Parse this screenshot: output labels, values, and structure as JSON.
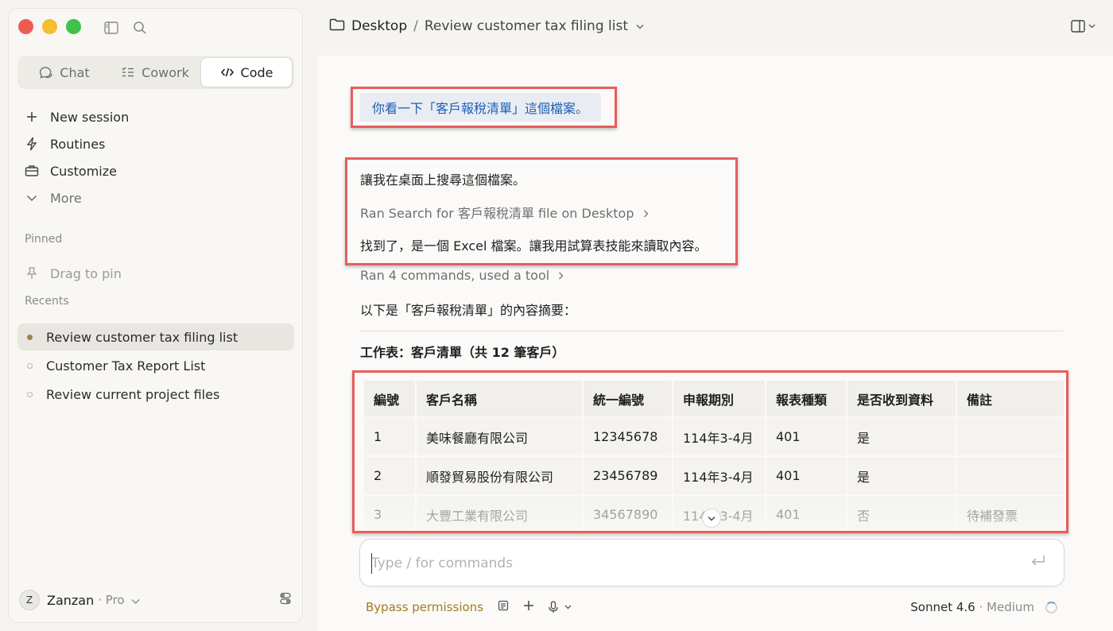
{
  "window": {
    "breadcrumb_root": "Desktop",
    "breadcrumb_separator": "/",
    "breadcrumb_page": "Review customer tax filing list"
  },
  "sidebar": {
    "modes": [
      {
        "label": "Chat",
        "icon": "chat-bubble-icon"
      },
      {
        "label": "Cowork",
        "icon": "checklist-icon"
      },
      {
        "label": "Code",
        "icon": "code-brackets-icon"
      }
    ],
    "active_mode": "Code",
    "nav": [
      {
        "label": "New session",
        "icon": "plus-icon"
      },
      {
        "label": "Routines",
        "icon": "bolt-icon"
      },
      {
        "label": "Customize",
        "icon": "briefcase-icon"
      },
      {
        "label": "More",
        "icon": "chevron-down-icon"
      }
    ],
    "pinned_label": "Pinned",
    "pinned_placeholder": "Drag to pin",
    "recents_label": "Recents",
    "recents": [
      {
        "label": "Review customer tax filing list",
        "active": true
      },
      {
        "label": "Customer Tax Report List",
        "active": false
      },
      {
        "label": "Review current project files",
        "active": false
      }
    ],
    "user": {
      "initial": "Z",
      "name": "Zanzan",
      "plan": "· Pro"
    }
  },
  "conversation": {
    "user_message": "你看一下「客戶報稅清單」這個檔案。",
    "reply_line_1": "讓我在桌面上搜尋這個檔案。",
    "tool_call_1": "Ran Search for 客戶報稅清單 file on Desktop",
    "reply_line_2": "找到了，是一個 Excel 檔案。讓我用試算表技能來讀取內容。",
    "tool_call_2": "Ran 4 commands, used a tool",
    "summary_intro": "以下是「客戶報稅清單」的內容摘要：",
    "sheet_heading": "工作表：客戶清單（共 12 筆客戶）"
  },
  "table": {
    "headers": [
      "編號",
      "客戶名稱",
      "統一編號",
      "申報期別",
      "報表種類",
      "是否收到資料",
      "備註"
    ],
    "rows": [
      [
        "1",
        "美味餐廳有限公司",
        "12345678",
        "114年3-4月",
        "401",
        "是",
        ""
      ],
      [
        "2",
        "順發貿易股份有限公司",
        "23456789",
        "114年3-4月",
        "401",
        "是",
        ""
      ],
      [
        "3",
        "大豐工業有限公司",
        "34567890",
        "114年3-4月",
        "401",
        "否",
        "待補發票"
      ]
    ]
  },
  "composer": {
    "placeholder": "Type / for commands"
  },
  "footer": {
    "permission_mode": "Bypass permissions",
    "model": "Sonnet 4.6",
    "effort": "· Medium"
  },
  "colors": {
    "highlight_border": "#e55e5e",
    "user_message_text": "#1a5fb4",
    "bypass_text": "#a07c1e",
    "active_recent_dot": "#a08446"
  }
}
